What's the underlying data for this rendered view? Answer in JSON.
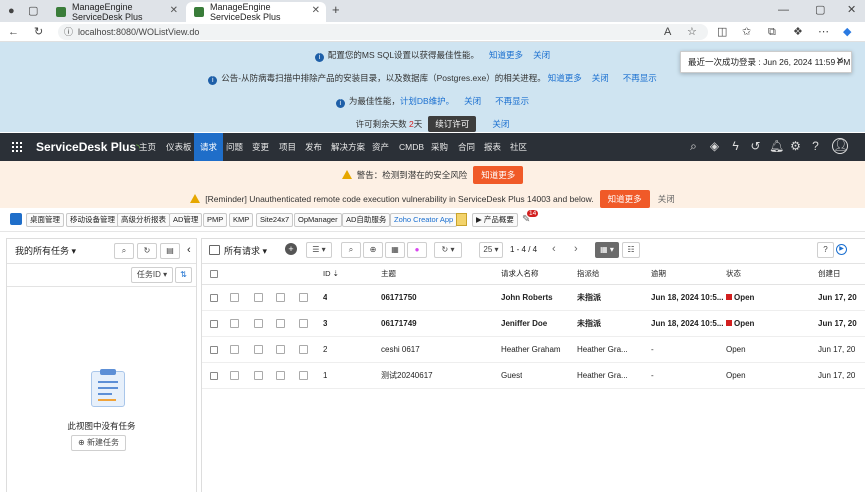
{
  "browser": {
    "tabs": [
      {
        "title": "ManageEngine ServiceDesk Plus"
      },
      {
        "title": "ManageEngine ServiceDesk Plus"
      }
    ],
    "url": "localhost:8080/WOListView.do"
  },
  "notices": {
    "mssql": {
      "text": "配置您的MS SQL设置以获得最佳性能。",
      "more": "知道更多",
      "close": "关闭"
    },
    "antivirus": {
      "text": "公告-从防病毒扫描中排除产品的安装目录，以及数据库（Postgres.exe）的相关进程。",
      "more": "知道更多",
      "close": "关闭",
      "hide": "不再显示"
    },
    "perf": {
      "text": "为最佳性能，",
      "link": "计划DB维护。",
      "close": "关闭",
      "hide": "不再显示"
    },
    "license": {
      "text_pre": "许可剩余天数 ",
      "days": "2",
      "text_post": "天",
      "renew": "续订许可",
      "close": "关闭"
    }
  },
  "toast": {
    "text": "最近一次成功登录 : Jun 26, 2024 11:59 PM"
  },
  "nav": {
    "brand": "ServiceDesk Plus",
    "items": [
      "主页",
      "仪表板",
      "请求",
      "问题",
      "变更",
      "项目",
      "发布",
      "解决方案",
      "资产",
      "CMDB",
      "采购",
      "合同",
      "报表",
      "社区"
    ]
  },
  "warning": {
    "security": {
      "text": "警告：检测到潜在的安全风险",
      "button": "知道更多"
    },
    "reminder": {
      "text": "[Reminder] Unauthenticated remote code execution vulnerability in ServiceDesk Plus 14003 and below.",
      "button": "知道更多",
      "close": "关闭"
    }
  },
  "quickbar": {
    "items": [
      "桌面管理",
      "移动设备管理",
      "高级分析报表",
      "AD管理",
      "PMP",
      "KMP",
      "Site24x7",
      "OpManager",
      "AD自助服务",
      "Zoho Creator App"
    ],
    "product_label": "产品概要",
    "badge": "14"
  },
  "tasks": {
    "title": "我的所有任务",
    "sort": "任务ID",
    "empty": "此视图中没有任务",
    "new_task": "新建任务"
  },
  "requests": {
    "view": "所有请求",
    "page_size": "25",
    "range": "1 - 4 / 4",
    "columns": [
      "ID",
      "主题",
      "请求人名称",
      "指派给",
      "逾期",
      "状态",
      "创建日"
    ],
    "rows": [
      {
        "id": "4",
        "subject": "06171750",
        "requester": "John Roberts",
        "assignee": "未指派",
        "due": "Jun 18, 2024 10:5...",
        "status": "Open",
        "created": "Jun 17, 20",
        "bold": true
      },
      {
        "id": "3",
        "subject": "06171749",
        "requester": "Jeniffer Doe",
        "assignee": "未指派",
        "due": "Jun 18, 2024 10:5...",
        "status": "Open",
        "created": "Jun 17, 20",
        "bold": true
      },
      {
        "id": "2",
        "subject": "ceshi 0617",
        "requester": "Heather Graham",
        "assignee": "Heather Gra...",
        "due": "-",
        "status": "Open",
        "created": "Jun 17, 20",
        "bold": false
      },
      {
        "id": "1",
        "subject": "测试20240617",
        "requester": "Guest",
        "assignee": "Heather Gra...",
        "due": "-",
        "status": "Open",
        "created": "Jun 17, 20",
        "bold": false
      }
    ]
  },
  "colors": {
    "nav_bg": "#2b3037",
    "nav_active": "#1f6ec9",
    "notice_bg": "#cfe4f1",
    "warn_bg": "#fdf0e4",
    "accent_orange": "#f05a28",
    "flag_red": "#d21f1f"
  }
}
